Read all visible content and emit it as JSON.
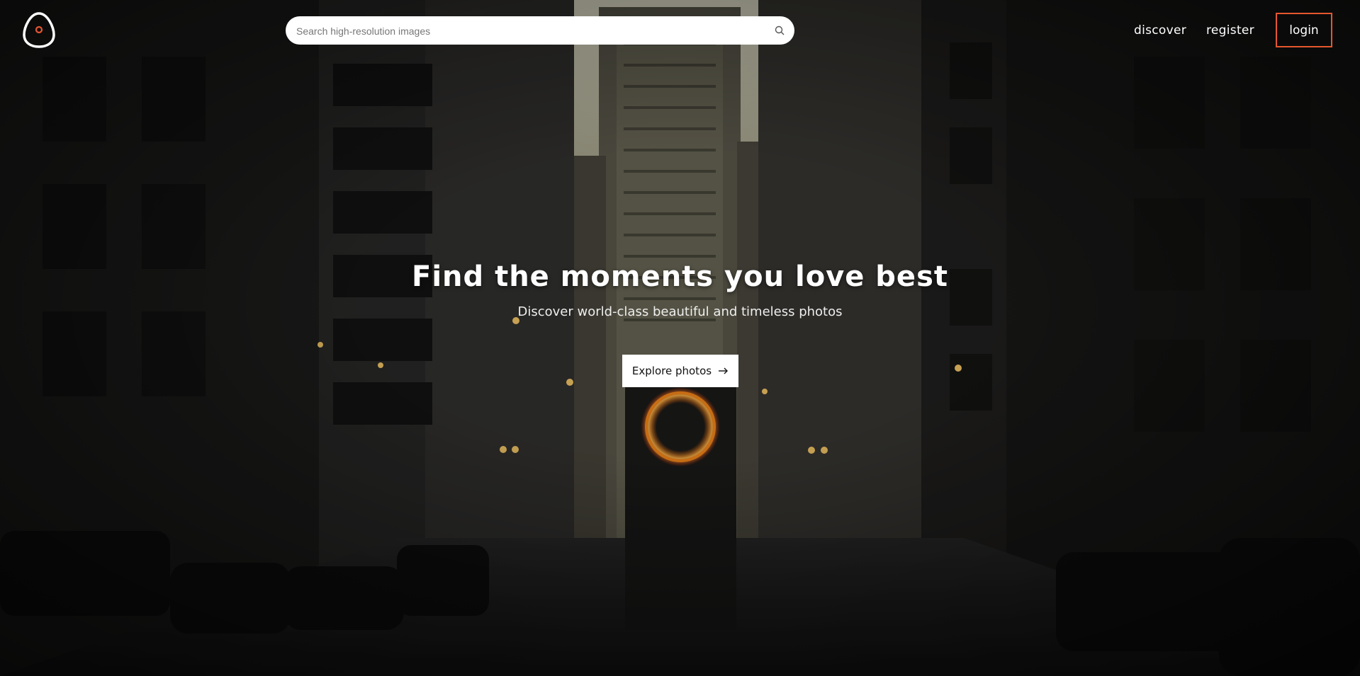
{
  "header": {
    "logo_icon": "egg-logo-icon",
    "search": {
      "placeholder": "Search high-resolution images",
      "value": "",
      "icon": "search-icon"
    },
    "nav": {
      "discover": "discover",
      "register": "register",
      "login": "login"
    }
  },
  "hero": {
    "title": "Find the moments you love best",
    "subtitle": "Discover world-class beautiful and timeless photos",
    "cta_label": "Explore photos",
    "cta_icon": "arrow-right-icon"
  },
  "colors": {
    "accent": "#e4572e",
    "overlay": "#000000"
  }
}
